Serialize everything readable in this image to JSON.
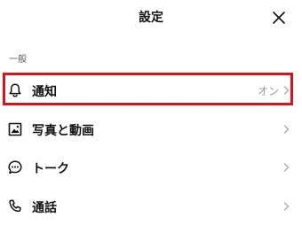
{
  "header": {
    "title": "設定",
    "close_icon": "close-icon"
  },
  "sections": [
    {
      "label": "一般",
      "items": [
        {
          "label": "通知",
          "value": "オン",
          "icon": "bell-icon",
          "highlighted": true
        },
        {
          "label": "写真と動画",
          "value": "",
          "icon": "photo-icon"
        },
        {
          "label": "トーク",
          "value": "",
          "icon": "chat-bubble-icon"
        },
        {
          "label": "通話",
          "value": "",
          "icon": "phone-icon"
        }
      ]
    }
  ],
  "colors": {
    "highlight": "#d7141d",
    "text": "#111111",
    "secondary_text": "#999999",
    "chevron": "#aaaaaa"
  }
}
